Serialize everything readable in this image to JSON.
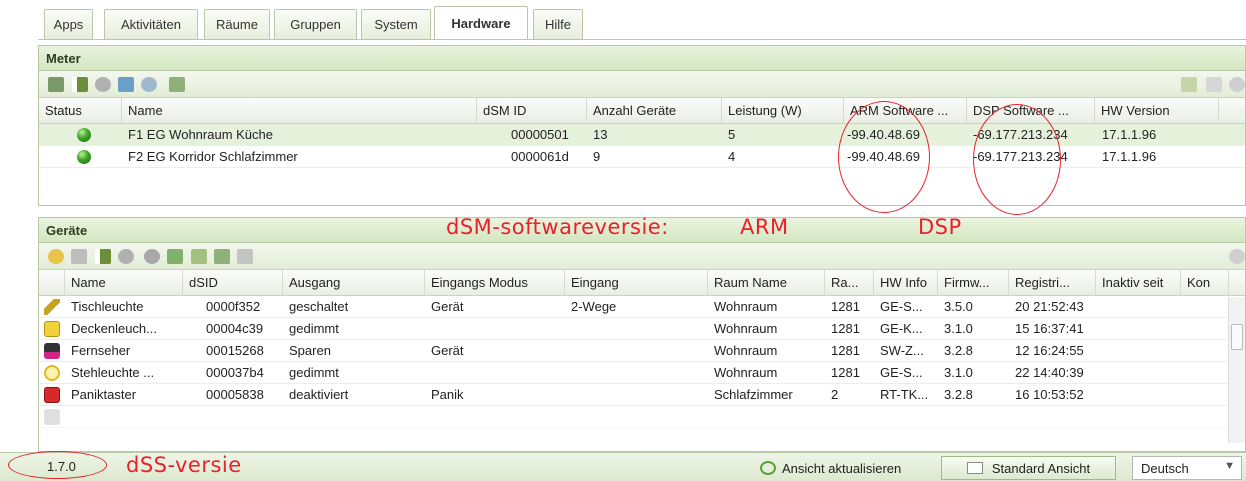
{
  "tabs": [
    {
      "label": "Apps"
    },
    {
      "label": "Aktivitäten"
    },
    {
      "label": "Räume"
    },
    {
      "label": "Gruppen"
    },
    {
      "label": "System"
    },
    {
      "label": "Hardware"
    },
    {
      "label": "Hilfe"
    }
  ],
  "meter": {
    "title": "Meter",
    "columns": [
      "Status",
      "Name",
      "dSM ID",
      "Anzahl Geräte",
      "Leistung (W)",
      "ARM Software ...",
      "DSP Software ...",
      "HW Version"
    ],
    "rows": [
      {
        "name": "F1 EG Wohnraum Küche",
        "dsm_id": "00000501",
        "count": "13",
        "power": "5",
        "arm": "-99.40.48.69",
        "dsp": "-69.177.213.234",
        "hw": "17.1.1.96"
      },
      {
        "name": "F2 EG Korridor Schlafzimmer",
        "dsm_id": "0000061d",
        "count": "9",
        "power": "4",
        "arm": "-99.40.48.69",
        "dsp": "-69.177.213.234",
        "hw": "17.1.1.96"
      }
    ]
  },
  "geraete": {
    "title": "Geräte",
    "columns": [
      "Name",
      "dSID",
      "Ausgang",
      "Eingangs Modus",
      "Eingang",
      "Raum Name",
      "Ra...",
      "HW Info",
      "Firmw...",
      "Registri...",
      "Inaktiv seit",
      "Kon"
    ],
    "rows": [
      {
        "icon": "pencil-icon",
        "name": "Tischleuchte",
        "dsid": "0000f352",
        "ausgang": "geschaltet",
        "modus": "Gerät",
        "eingang": "2-Wege",
        "raum": "Wohnraum",
        "ra": "1281",
        "hw": "GE-S...",
        "fw": "3.5.0",
        "reg": "20 21:52:43"
      },
      {
        "icon": "yellow-cube-icon",
        "name": "Deckenleuch...",
        "dsid": "00004c39",
        "ausgang": "gedimmt",
        "modus": "",
        "eingang": "",
        "raum": "Wohnraum",
        "ra": "1281",
        "hw": "GE-K...",
        "fw": "3.1.0",
        "reg": "15 16:37:41"
      },
      {
        "icon": "media-icon",
        "name": "Fernseher",
        "dsid": "00015268",
        "ausgang": "Sparen",
        "modus": "Gerät",
        "eingang": "",
        "raum": "Wohnraum",
        "ra": "1281",
        "hw": "SW-Z...",
        "fw": "3.2.8",
        "reg": "12 16:24:55"
      },
      {
        "icon": "lamp-icon",
        "name": "Stehleuchte ...",
        "dsid": "000037b4",
        "ausgang": "gedimmt",
        "modus": "",
        "eingang": "",
        "raum": "Wohnraum",
        "ra": "1281",
        "hw": "GE-S...",
        "fw": "3.1.0",
        "reg": "22 14:40:39"
      },
      {
        "icon": "red-cube-icon",
        "name": "Paniktaster",
        "dsid": "00005838",
        "ausgang": "deaktiviert",
        "modus": "Panik",
        "eingang": "",
        "raum": "Schlafzimmer",
        "ra": "2",
        "hw": "RT-TK...",
        "fw": "3.2.8",
        "reg": "16 10:53:52"
      }
    ]
  },
  "annotations": {
    "dsm_label": "dSM-softwareversie:",
    "arm": "ARM",
    "dsp": "DSP",
    "dss_label": "dSS-versie"
  },
  "footer": {
    "version": "1.7.0",
    "refresh_label": "Ansicht aktualisieren",
    "standard_view_label": "Standard Ansicht",
    "language": "Deutsch"
  },
  "colors": {
    "accent_green": "#d3e6c0",
    "annotation_red": "#e8212a",
    "status_green": "#3da325"
  }
}
